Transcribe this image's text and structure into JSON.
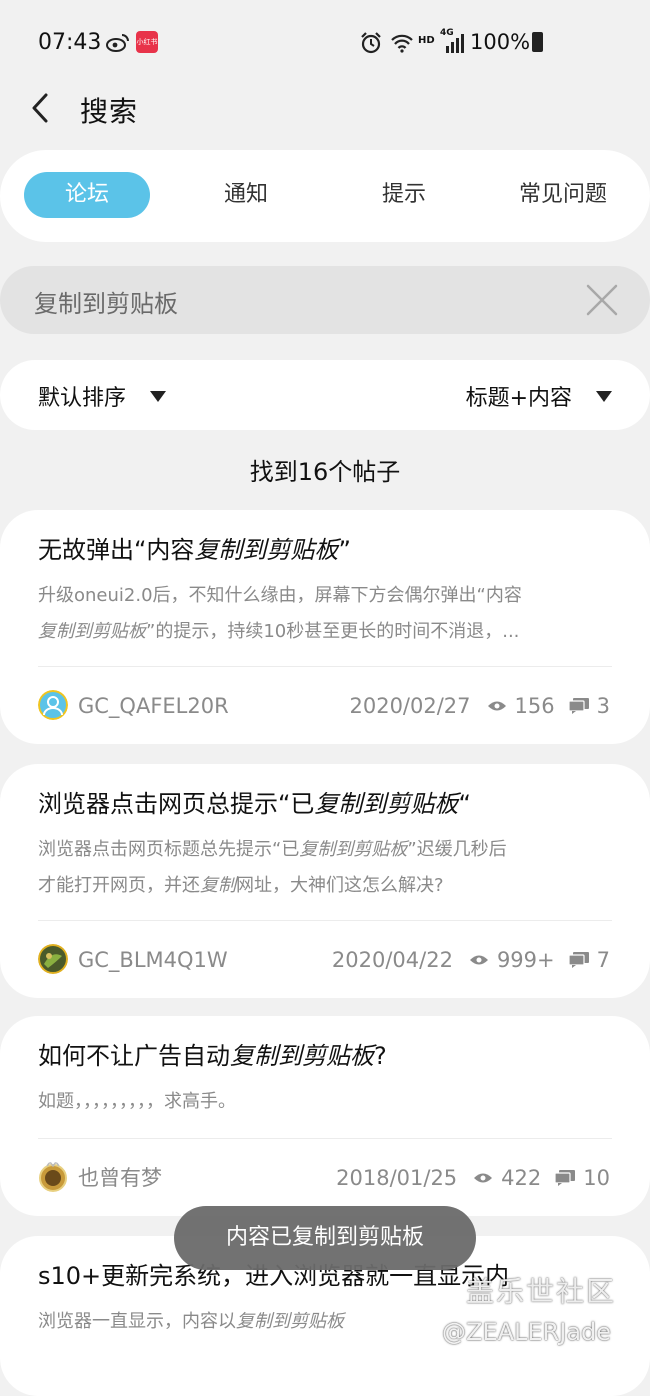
{
  "status": {
    "time": "07:43",
    "redbook": "小红书",
    "hd": "HD",
    "net": "4G",
    "battery": "100%"
  },
  "header": {
    "title": "搜索"
  },
  "tabs": [
    {
      "label": "论坛",
      "active": true
    },
    {
      "label": "通知",
      "active": false
    },
    {
      "label": "提示",
      "active": false
    },
    {
      "label": "常见问题",
      "active": false
    }
  ],
  "search": {
    "value": "复制到剪贴板"
  },
  "sort": {
    "order": "默认排序",
    "scope": "标题+内容"
  },
  "results": {
    "found": "找到16个帖子"
  },
  "posts": [
    {
      "title_pre": "无故弹出“内容",
      "title_hl": "复制到剪贴板",
      "title_post": "”",
      "excerpt_l1": "升级oneui2.0后，不知什么缘由，屏幕下方会偶尔弹出“内容",
      "excerpt_l2_hl": "复制到剪贴板",
      "excerpt_l2": "”的提示，持续10秒甚至更长的时间不消退，...",
      "author": "GC_QAFEL20R",
      "date": "2020/02/27",
      "views": "156",
      "replies": "3"
    },
    {
      "title_pre": "浏览器点击网页总提示“已",
      "title_hl": "复制到剪贴板",
      "title_post": "“",
      "excerpt_l1_pre": "浏览器点击网页标题总先提示“已",
      "excerpt_l1_hl": "复制到剪贴板",
      "excerpt_l1_post": "”迟缓几秒后",
      "excerpt_l2_pre": "才能打开网页，并还",
      "excerpt_l2_hl": "复制",
      "excerpt_l2_post": "网址，大神们这怎么解决?",
      "author": "GC_BLM4Q1W",
      "date": "2020/04/22",
      "views": "999+",
      "replies": "7"
    },
    {
      "title_pre": "如何不让广告自动",
      "title_hl": "复制到剪贴板",
      "title_post": "?",
      "excerpt": "如题，，，，，，，，，求高手。",
      "author": "也曾有梦",
      "date": "2018/01/25",
      "views": "422",
      "replies": "10"
    },
    {
      "title": "s10+更新完系统，进入浏览器就一直显示内",
      "excerpt_pre": "浏览器一直显示，内容以",
      "excerpt_hl": "复制到剪贴板"
    }
  ],
  "toast": {
    "text": "内容已复制到剪贴板"
  },
  "watermark": {
    "line1": "盖乐世社区",
    "line2": "@ZEALERJade"
  },
  "colors": {
    "accent": "#5bc3e8",
    "background": "#f1f1f1",
    "card": "#ffffff",
    "muted": "#8a8a8a"
  }
}
